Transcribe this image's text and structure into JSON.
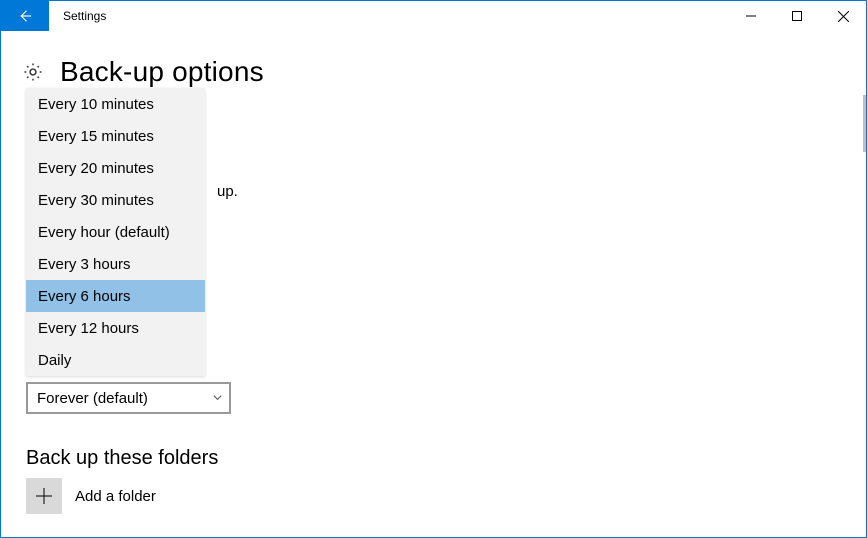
{
  "window": {
    "title": "Settings"
  },
  "header": {
    "title": "Back-up options"
  },
  "background": {
    "partial_text": "up."
  },
  "keep_combo": {
    "value": "Forever (default)"
  },
  "section": {
    "title": "Back up these folders",
    "add_label": "Add a folder"
  },
  "dropdown": {
    "items": [
      "Every 10 minutes",
      "Every 15 minutes",
      "Every 20 minutes",
      "Every 30 minutes",
      "Every hour (default)",
      "Every 3 hours",
      "Every 6 hours",
      "Every 12 hours",
      "Daily"
    ],
    "selected_index": 6
  }
}
